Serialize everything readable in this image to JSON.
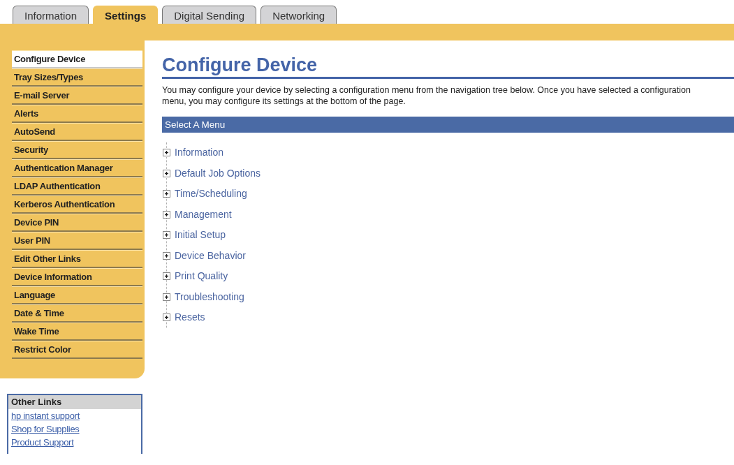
{
  "tabs": [
    {
      "label": "Information",
      "selected": false
    },
    {
      "label": "Settings",
      "selected": true
    },
    {
      "label": "Digital Sending",
      "selected": false
    },
    {
      "label": "Networking",
      "selected": false
    }
  ],
  "sidebar": {
    "items": [
      {
        "label": "Configure Device",
        "selected": true
      },
      {
        "label": "Tray Sizes/Types",
        "selected": false
      },
      {
        "label": "E-mail Server",
        "selected": false
      },
      {
        "label": "Alerts",
        "selected": false
      },
      {
        "label": "AutoSend",
        "selected": false
      },
      {
        "label": "Security",
        "selected": false
      },
      {
        "label": "Authentication Manager",
        "selected": false
      },
      {
        "label": "LDAP Authentication",
        "selected": false
      },
      {
        "label": "Kerberos Authentication",
        "selected": false
      },
      {
        "label": "Device PIN",
        "selected": false
      },
      {
        "label": "User PIN",
        "selected": false
      },
      {
        "label": "Edit Other Links",
        "selected": false
      },
      {
        "label": "Device Information",
        "selected": false
      },
      {
        "label": "Language",
        "selected": false
      },
      {
        "label": "Date & Time",
        "selected": false
      },
      {
        "label": "Wake Time",
        "selected": false
      },
      {
        "label": "Restrict Color",
        "selected": false
      }
    ]
  },
  "other_links": {
    "title": "Other Links",
    "links": [
      "hp instant support",
      "Shop for Supplies",
      "Product Support"
    ]
  },
  "main": {
    "title": "Configure Device",
    "description": "You may configure your device by selecting a configuration menu from the navigation tree below. Once you have selected a configuration menu, you may configure its settings at the bottom of the page.",
    "menu_header": "Select A Menu",
    "tree": [
      {
        "label": "Information",
        "expanded": false
      },
      {
        "label": "Default Job Options",
        "expanded": false
      },
      {
        "label": "Time/Scheduling",
        "expanded": false
      },
      {
        "label": "Management",
        "expanded": false
      },
      {
        "label": "Initial Setup",
        "expanded": false
      },
      {
        "label": "Device Behavior",
        "expanded": false
      },
      {
        "label": "Print Quality",
        "expanded": false
      },
      {
        "label": "Troubleshooting",
        "expanded": false
      },
      {
        "label": "Resets",
        "expanded": false
      }
    ]
  }
}
